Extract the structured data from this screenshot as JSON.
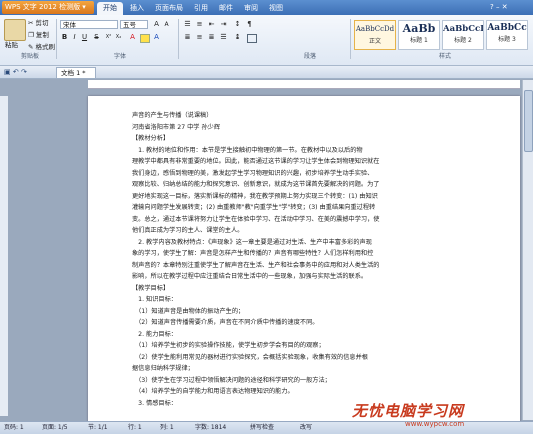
{
  "app": {
    "menu_label": "WPS 文字 2012 检测版 ▾",
    "tabs": [
      "开始",
      "插入",
      "页面布局",
      "引用",
      "邮件",
      "审阅",
      "视图"
    ]
  },
  "ribbon": {
    "paste_label": "粘贴",
    "cut_label": "剪切",
    "copy_label": "复制",
    "format_painter_label": "格式刷",
    "font_name": "宋体",
    "font_size": "五号",
    "groups": {
      "clipboard": "剪贴板",
      "font": "字体",
      "paragraph": "段落",
      "styles": "样式"
    },
    "styles": [
      {
        "sample": "AaBbCcDd",
        "name": "正文"
      },
      {
        "sample": "AaBb",
        "name": "标题 1"
      },
      {
        "sample": "AaBbCcDd",
        "name": "标题 2"
      },
      {
        "sample": "AaBbCc",
        "name": "标题 3"
      }
    ]
  },
  "document": {
    "tab_label": "文档 1 *",
    "lines": [
      "声音的产生与传播（说课稿）",
      "河南省洛阳市第 27 中学   孙少辉",
      "【教材分析】",
      "　1. 教材的地位和作用：本节是学生接触初中物理的第一节。在教材中以及以后的物",
      "理教学中都具有非常重要的地位。因此，能否通过这节课的学习让学生体会到物理知识就在",
      "我们身边，感悟到物理的美，激发起学生学习物理知识的兴趣，初步培养学生动手实验、",
      "观察比较、归纳总结的能力和探究意识、创新意识，就成为这节课首先要解决的问题。为了",
      "更好地实现这一目标，落实新课标的精神，我在教学预期上努力实现三个转变：(1) 由知识",
      "灌输向问题学生发展转变；(2) 由重教师\"教\"向重学生\"学\"转变；(3) 由重结果向重过程转",
      "变。总之，通过本节课将努力让学生在体验中学习、在活动中学习、在美的震撼中学习，使",
      "他们真正成为学习的主人、课堂的主人。",
      "　2. 教学内容及教材特点：《声现象》这一章主要是通过对生活、生产中丰富多彩的声现",
      "象的学习，使学生了解：声音是怎样产生和传播的？声音有哪些特性？人们怎样利用和控",
      "制声音的？本章特别注重使学生了解声音在生活、生产和社会事务中的应用和对人类生活的",
      "影响，所以在教学过程中应注重结合日常生活中的一些现象，加强与实际生活的联系。",
      "【教学目标】",
      "　1. 知识目标：",
      "　（1）知道声音是由物体的振动产生的；",
      "　（2）知道声音传播需要介质，声音在不同介质中传播的速度不同。",
      "　2. 能力目标：",
      "　（1）培养学生初步的实验操作技能，使学生初步学会有目的的观察；",
      "　（2）使学生能利用常见的器材进行实验探究，会概括实验现象，收集有效的信息并根",
      "据信息归纳科学规律；",
      "　（3）使学生在学习过程中领悟解决问题的途径和科学研究的一般方法；",
      "　（4）培养学生的自学能力和用语言表达物理知识的能力。",
      "　3. 情感目标："
    ]
  },
  "status": {
    "page": "页码: 1",
    "pages": "页面: 1/5",
    "section": "节: 1/1",
    "row": "行: 1",
    "column": "列: 1",
    "word_count": "字数: 1814",
    "spelling": "拼写检查",
    "insert_mode": "改写"
  },
  "watermark": {
    "title": "无忧电脑学习网",
    "url": "www.wypcw.com"
  }
}
